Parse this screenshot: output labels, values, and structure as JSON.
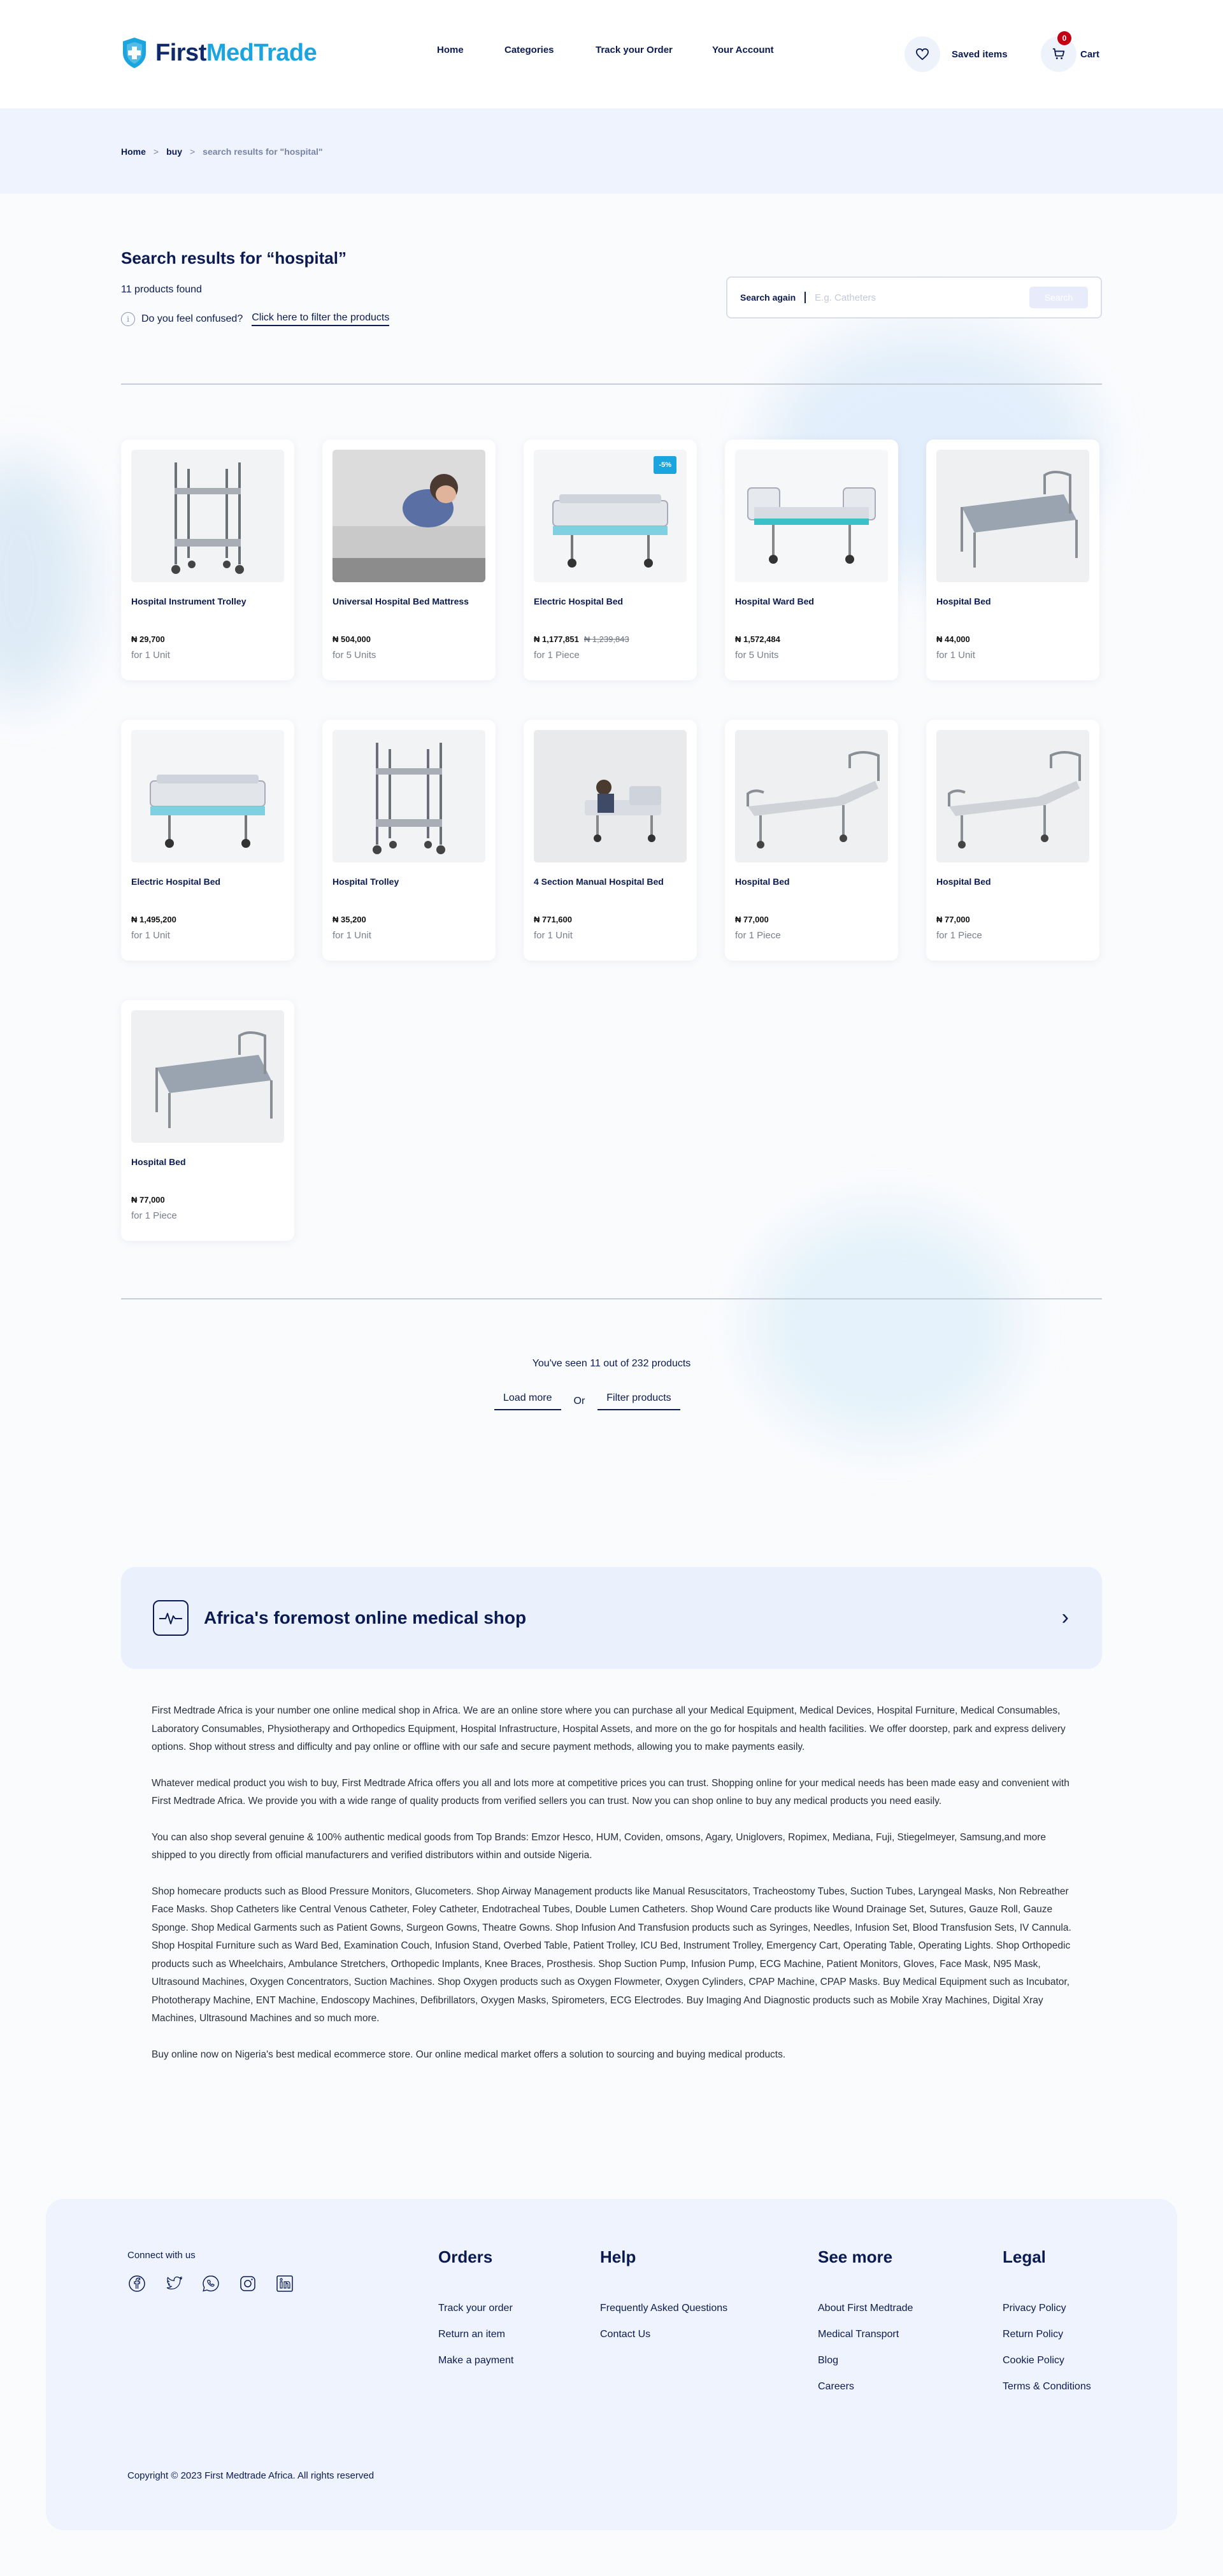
{
  "brand": {
    "name_part1": "First",
    "name_part2": "MedTrade"
  },
  "nav": {
    "home": "Home",
    "categories": "Categories",
    "track": "Track your Order",
    "account": "Your Account"
  },
  "header": {
    "saved_label": "Saved items",
    "cart_label": "Cart",
    "cart_count": "0"
  },
  "breadcrumb": {
    "home": "Home",
    "buy": "buy",
    "current": "search results for \"hospital\"",
    "separator": ">"
  },
  "search": {
    "title": "Search results for “hospital”",
    "count_text": "11 products found",
    "confused_text": "Do you feel confused?",
    "filter_link": "Click here to filter the products",
    "again_label": "Search again",
    "placeholder": "E.g. Catheters",
    "button": "Search"
  },
  "products": [
    {
      "name": "Hospital Instrument Trolley",
      "price": "₦ 29,700",
      "old_price": "",
      "unit": "for 1 Unit",
      "discount": "",
      "image": "trolley-icon"
    },
    {
      "name": "Universal Hospital Bed Mattress",
      "price": "₦ 504,000",
      "old_price": "",
      "unit": "for 5 Units",
      "discount": "",
      "image": "mattress-icon"
    },
    {
      "name": "Electric Hospital Bed",
      "price": "₦ 1,177,851",
      "old_price": "₦ 1,239,843",
      "unit": "for 1 Piece",
      "discount": "-5%",
      "image": "electric-bed-icon"
    },
    {
      "name": "Hospital Ward Bed",
      "price": "₦ 1,572,484",
      "old_price": "",
      "unit": "for 5 Units",
      "discount": "",
      "image": "ward-bed-icon"
    },
    {
      "name": "Hospital Bed",
      "price": "₦ 44,000",
      "old_price": "",
      "unit": "for 1 Unit",
      "discount": "",
      "image": "bed-frame-icon"
    },
    {
      "name": "Electric Hospital Bed",
      "price": "₦ 1,495,200",
      "old_price": "",
      "unit": "for 1 Unit",
      "discount": "",
      "image": "electric-bed-icon"
    },
    {
      "name": "Hospital Trolley",
      "price": "₦ 35,200",
      "old_price": "",
      "unit": "for 1 Unit",
      "discount": "",
      "image": "trolley-icon"
    },
    {
      "name": "4 Section Manual Hospital Bed",
      "price": "₦ 771,600",
      "old_price": "",
      "unit": "for 1 Unit",
      "discount": "",
      "image": "manual-bed-icon"
    },
    {
      "name": "Hospital Bed",
      "price": "₦ 77,000",
      "old_price": "",
      "unit": "for 1 Piece",
      "discount": "",
      "image": "recline-bed-icon"
    },
    {
      "name": "Hospital Bed",
      "price": "₦ 77,000",
      "old_price": "",
      "unit": "for 1 Piece",
      "discount": "",
      "image": "recline-bed-icon"
    },
    {
      "name": "Hospital Bed",
      "price": "₦ 77,000",
      "old_price": "",
      "unit": "for 1 Piece",
      "discount": "",
      "image": "bed-frame-icon"
    }
  ],
  "pagination": {
    "seen_text": "You've seen 11 out of 232 products",
    "load_more": "Load more",
    "or": "Or",
    "filter": "Filter products"
  },
  "about": {
    "banner_title": "Africa's foremost online medical shop",
    "paragraphs": [
      "First Medtrade Africa is your number one online medical shop in Africa. We are an online store where you can purchase all your Medical Equipment, Medical Devices, Hospital Furniture, Medical Consumables, Laboratory Consumables, Physiotherapy and Orthopedics Equipment, Hospital Infrastructure, Hospital Assets, and more on the go for hospitals and health facilities. We offer doorstep, park and express delivery options. Shop without stress and difficulty and pay online or offline with our safe and secure payment methods, allowing you to make payments easily.",
      "Whatever medical product you wish to buy, First Medtrade Africa offers you all and lots more at competitive prices you can trust. Shopping online for your medical needs has been made easy and convenient with First Medtrade Africa. We provide you with a wide range of quality products from verified sellers you can trust. Now you can shop online to buy any medical products you need easily.",
      "You can also shop several genuine & 100% authentic medical goods from Top Brands: Emzor Hesco, HUM, Coviden, omsons, Agary, Uniglovers, Ropimex, Mediana, Fuji, Stiegelmeyer, Samsung,and more shipped to you directly from official manufacturers and verified distributors within and outside Nigeria.",
      "Shop homecare products such as Blood Pressure Monitors, Glucometers. Shop Airway Management products like Manual Resuscitators, Tracheostomy Tubes, Suction Tubes, Laryngeal Masks, Non Rebreather Face Masks. Shop Catheters like Central Venous Catheter, Foley Catheter, Endotracheal Tubes, Double Lumen Catheters. Shop Wound Care products like Wound Drainage Set, Sutures, Gauze Roll, Gauze Sponge. Shop Medical Garments such as Patient Gowns, Surgeon Gowns, Theatre Gowns. Shop Infusion And Transfusion products such as Syringes, Needles, Infusion Set, Blood Transfusion Sets, IV Cannula. Shop Hospital Furniture such as Ward Bed, Examination Couch, Infusion Stand, Overbed Table, Patient Trolley, ICU Bed, Instrument Trolley, Emergency Cart, Operating Table, Operating Lights. Shop Orthopedic products such as Wheelchairs, Ambulance Stretchers, Orthopedic Implants, Knee Braces, Prosthesis. Shop Suction Pump, Infusion Pump, ECG Machine, Patient Monitors, Gloves, Face Mask, N95 Mask, Ultrasound Machines, Oxygen Concentrators, Suction Machines. Shop Oxygen products such as Oxygen Flowmeter, Oxygen Cylinders, CPAP Machine, CPAP Masks. Buy Medical Equipment such as Incubator, Phototherapy Machine, ENT Machine, Endoscopy Machines, Defibrillators, Oxygen Masks, Spirometers, ECG Electrodes. Buy Imaging And Diagnostic products such as Mobile Xray Machines, Digital Xray Machines, Ultrasound Machines and so much more.",
      "Buy online now on Nigeria's best medical ecommerce store. Our online medical market offers a solution to sourcing and buying medical products."
    ]
  },
  "footer": {
    "connect": "Connect with us",
    "socials": [
      "facebook-icon",
      "twitter-icon",
      "whatsapp-icon",
      "instagram-icon",
      "linkedin-icon"
    ],
    "columns": [
      {
        "title": "Orders",
        "links": [
          "Track your order",
          "Return an item",
          "Make a payment"
        ]
      },
      {
        "title": "Help",
        "links": [
          "Frequently Asked Questions",
          "Contact Us"
        ]
      },
      {
        "title": "See more",
        "links": [
          "About First Medtrade",
          "Medical Transport",
          "Blog",
          "Careers"
        ]
      },
      {
        "title": "Legal",
        "links": [
          "Privacy Policy",
          "Return Policy",
          "Cookie Policy",
          "Terms & Conditions"
        ]
      }
    ],
    "copyright": "Copyright © 2023 First Medtrade Africa. All rights reserved"
  },
  "colors": {
    "navy": "#0b1b52",
    "brand_blue": "#1ba5df",
    "badge_red": "#c20012",
    "band": "#eff3fd"
  }
}
